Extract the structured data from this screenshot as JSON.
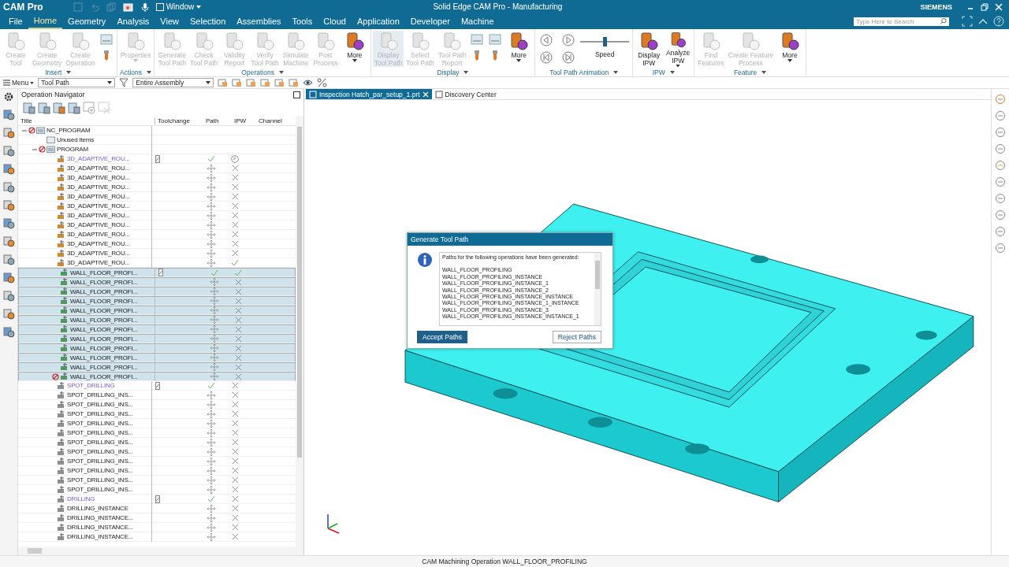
{
  "window": {
    "app_name": "CAM Pro",
    "quick_menu": "Window",
    "title": "Solid Edge CAM Pro - Manufacturing",
    "brand": "SIEMENS"
  },
  "menu": [
    {
      "label": "File",
      "selected": false
    },
    {
      "label": "Home",
      "selected": true
    },
    {
      "label": "Geometry",
      "selected": false
    },
    {
      "label": "Analysis",
      "selected": false
    },
    {
      "label": "View",
      "selected": false
    },
    {
      "label": "Selection",
      "selected": false
    },
    {
      "label": "Assemblies",
      "selected": false
    },
    {
      "label": "Tools",
      "selected": false
    },
    {
      "label": "Cloud",
      "selected": false
    },
    {
      "label": "Application",
      "selected": false
    },
    {
      "label": "Developer",
      "selected": false
    },
    {
      "label": "Machine",
      "selected": false
    }
  ],
  "search": {
    "placeholder": "Type Here to Search"
  },
  "ribbon": [
    {
      "label": "Insert",
      "kind": "buttons",
      "buttons": [
        {
          "kind": "large",
          "lines": [
            "Create",
            "Tool"
          ],
          "disabled": true,
          "pressed": false,
          "menu": false
        },
        {
          "kind": "large",
          "lines": [
            "Create",
            "Geometry"
          ],
          "disabled": true,
          "pressed": false,
          "menu": false
        },
        {
          "kind": "large",
          "lines": [
            "Create",
            "Operation"
          ],
          "disabled": true,
          "pressed": false,
          "menu": false
        },
        {
          "kind": "icon_stack"
        }
      ]
    },
    {
      "label": "Actions",
      "kind": "buttons",
      "buttons": [
        {
          "kind": "large",
          "lines": [
            "Properties"
          ],
          "disabled": true,
          "pressed": false,
          "menu": true
        }
      ]
    },
    {
      "label": "Operations",
      "kind": "buttons",
      "buttons": [
        {
          "kind": "large",
          "lines": [
            "Generate",
            "Tool Path"
          ],
          "disabled": true,
          "pressed": false,
          "menu": false
        },
        {
          "kind": "large",
          "lines": [
            "Check",
            "Tool Path"
          ],
          "disabled": true,
          "pressed": false,
          "menu": false
        },
        {
          "kind": "large",
          "lines": [
            "Validity",
            "Report"
          ],
          "disabled": true,
          "pressed": false,
          "menu": false
        },
        {
          "kind": "large",
          "lines": [
            "Verify",
            "Tool Path"
          ],
          "disabled": true,
          "pressed": false,
          "menu": false
        },
        {
          "kind": "large",
          "lines": [
            "Simulate",
            "Machine"
          ],
          "disabled": true,
          "pressed": false,
          "menu": false
        },
        {
          "kind": "large",
          "lines": [
            "Post",
            "Process"
          ],
          "disabled": true,
          "pressed": false,
          "menu": false
        },
        {
          "kind": "large",
          "lines": [
            "More"
          ],
          "disabled": false,
          "pressed": false,
          "menu": true
        }
      ]
    },
    {
      "label": "Display",
      "kind": "buttons",
      "buttons": [
        {
          "kind": "large",
          "lines": [
            "Display",
            "Tool Path"
          ],
          "disabled": true,
          "pressed": true,
          "menu": false
        },
        {
          "kind": "large",
          "lines": [
            "Select",
            "Tool Path"
          ],
          "disabled": true,
          "pressed": false,
          "menu": false
        },
        {
          "kind": "large",
          "lines": [
            "Tool Path",
            "Report"
          ],
          "disabled": true,
          "pressed": false,
          "menu": false
        },
        {
          "kind": "icon_stack"
        },
        {
          "kind": "icon_stack"
        },
        {
          "kind": "large",
          "lines": [
            "More"
          ],
          "disabled": false,
          "pressed": false,
          "menu": true
        }
      ]
    },
    {
      "label": "Tool Path Animation",
      "kind": "animation",
      "speed": {
        "label": "Speed",
        "level": 0.5
      }
    },
    {
      "label": "IPW",
      "kind": "buttons",
      "buttons": [
        {
          "kind": "large",
          "lines": [
            "Display",
            "IPW"
          ],
          "disabled": false,
          "pressed": false,
          "menu": false
        },
        {
          "kind": "large",
          "lines": [
            "Analyze",
            "IPW"
          ],
          "disabled": false,
          "pressed": false,
          "menu": true
        }
      ]
    },
    {
      "label": "Feature",
      "kind": "buttons",
      "buttons": [
        {
          "kind": "large",
          "lines": [
            "Find",
            "Features"
          ],
          "disabled": true,
          "pressed": false,
          "menu": false
        },
        {
          "kind": "large",
          "lines": [
            "Create Feature",
            "Process"
          ],
          "disabled": true,
          "pressed": false,
          "menu": false
        },
        {
          "kind": "large",
          "lines": [
            "More"
          ],
          "disabled": false,
          "pressed": false,
          "menu": true
        }
      ]
    }
  ],
  "toolbar": {
    "menu_label": "Menu",
    "filter": "Tool Path",
    "scope": "Entire Assembly"
  },
  "navigator": {
    "title": "Operation Navigator",
    "columns": [
      "Title",
      "Toolchange",
      "Path",
      "IPW",
      "Channel"
    ],
    "tree": [
      {
        "title": "NC_PROGRAM",
        "kind": "program",
        "expanded": true,
        "error": true,
        "selected": false,
        "children": [
          {
            "title": "Unused Items",
            "kind": "folder",
            "error": false,
            "selected": false
          },
          {
            "title": "PROGRAM",
            "kind": "program",
            "expanded": true,
            "error": true,
            "selected": false,
            "children": [
              {
                "title": "3D_ADAPTIVE_ROU...",
                "kind": "adaptive",
                "emphasized": true,
                "error": false,
                "selected": false,
                "toolchange": true,
                "path_done": true,
                "ipw_done": false,
                "ipw_pending": true
              },
              {
                "title": "3D_ADAPTIVE_ROU...",
                "kind": "adaptive",
                "emphasized": false,
                "error": false,
                "selected": false,
                "toolchange": false,
                "path_done": false,
                "ipw_done": false,
                "ipw_pending": false
              },
              {
                "title": "3D_ADAPTIVE_ROU...",
                "kind": "adaptive",
                "emphasized": false,
                "error": false,
                "selected": false,
                "toolchange": false,
                "path_done": false,
                "ipw_done": false,
                "ipw_pending": false
              },
              {
                "title": "3D_ADAPTIVE_ROU...",
                "kind": "adaptive",
                "emphasized": false,
                "error": false,
                "selected": false,
                "toolchange": false,
                "path_done": false,
                "ipw_done": false,
                "ipw_pending": false
              },
              {
                "title": "3D_ADAPTIVE_ROU...",
                "kind": "adaptive",
                "emphasized": false,
                "error": false,
                "selected": false,
                "toolchange": false,
                "path_done": false,
                "ipw_done": false,
                "ipw_pending": false
              },
              {
                "title": "3D_ADAPTIVE_ROU...",
                "kind": "adaptive",
                "emphasized": false,
                "error": false,
                "selected": false,
                "toolchange": false,
                "path_done": false,
                "ipw_done": false,
                "ipw_pending": false
              },
              {
                "title": "3D_ADAPTIVE_ROU...",
                "kind": "adaptive",
                "emphasized": false,
                "error": false,
                "selected": false,
                "toolchange": false,
                "path_done": false,
                "ipw_done": false,
                "ipw_pending": false
              },
              {
                "title": "3D_ADAPTIVE_ROU...",
                "kind": "adaptive",
                "emphasized": false,
                "error": false,
                "selected": false,
                "toolchange": false,
                "path_done": false,
                "ipw_done": false,
                "ipw_pending": false
              },
              {
                "title": "3D_ADAPTIVE_ROU...",
                "kind": "adaptive",
                "emphasized": false,
                "error": false,
                "selected": false,
                "toolchange": false,
                "path_done": false,
                "ipw_done": false,
                "ipw_pending": false
              },
              {
                "title": "3D_ADAPTIVE_ROU...",
                "kind": "adaptive",
                "emphasized": false,
                "error": false,
                "selected": false,
                "toolchange": false,
                "path_done": false,
                "ipw_done": false,
                "ipw_pending": false
              },
              {
                "title": "3D_ADAPTIVE_ROU...",
                "kind": "adaptive",
                "emphasized": false,
                "error": false,
                "selected": false,
                "toolchange": false,
                "path_done": false,
                "ipw_done": false,
                "ipw_pending": false
              },
              {
                "title": "3D_ADAPTIVE_ROU...",
                "kind": "adaptive",
                "emphasized": false,
                "error": false,
                "selected": false,
                "toolchange": false,
                "path_done": false,
                "ipw_done": true,
                "ipw_pending": false
              },
              {
                "title": "WALL_FLOOR_PROFI...",
                "kind": "wall",
                "emphasized": false,
                "error": false,
                "selected": true,
                "toolchange": true,
                "path_done": true,
                "ipw_done": true,
                "ipw_pending": false
              },
              {
                "title": "WALL_FLOOR_PROFI...",
                "kind": "wall",
                "emphasized": false,
                "error": false,
                "selected": true,
                "toolchange": false,
                "path_done": false,
                "ipw_done": false,
                "ipw_pending": false
              },
              {
                "title": "WALL_FLOOR_PROFI...",
                "kind": "wall",
                "emphasized": false,
                "error": false,
                "selected": true,
                "toolchange": false,
                "path_done": false,
                "ipw_done": false,
                "ipw_pending": false
              },
              {
                "title": "WALL_FLOOR_PROFI...",
                "kind": "wall",
                "emphasized": false,
                "error": false,
                "selected": true,
                "toolchange": false,
                "path_done": false,
                "ipw_done": false,
                "ipw_pending": false
              },
              {
                "title": "WALL_FLOOR_PROFI...",
                "kind": "wall",
                "emphasized": false,
                "error": false,
                "selected": true,
                "toolchange": false,
                "path_done": false,
                "ipw_done": false,
                "ipw_pending": false
              },
              {
                "title": "WALL_FLOOR_PROFI...",
                "kind": "wall",
                "emphasized": false,
                "error": false,
                "selected": true,
                "toolchange": false,
                "path_done": false,
                "ipw_done": false,
                "ipw_pending": false
              },
              {
                "title": "WALL_FLOOR_PROFI...",
                "kind": "wall",
                "emphasized": false,
                "error": false,
                "selected": true,
                "toolchange": false,
                "path_done": false,
                "ipw_done": false,
                "ipw_pending": false
              },
              {
                "title": "WALL_FLOOR_PROFI...",
                "kind": "wall",
                "emphasized": false,
                "error": false,
                "selected": true,
                "toolchange": false,
                "path_done": false,
                "ipw_done": false,
                "ipw_pending": false
              },
              {
                "title": "WALL_FLOOR_PROFI...",
                "kind": "wall",
                "emphasized": false,
                "error": false,
                "selected": true,
                "toolchange": false,
                "path_done": false,
                "ipw_done": false,
                "ipw_pending": false
              },
              {
                "title": "WALL_FLOOR_PROFI...",
                "kind": "wall",
                "emphasized": false,
                "error": false,
                "selected": true,
                "toolchange": false,
                "path_done": false,
                "ipw_done": false,
                "ipw_pending": false
              },
              {
                "title": "WALL_FLOOR_PROFI...",
                "kind": "wall",
                "emphasized": false,
                "error": false,
                "selected": true,
                "toolchange": false,
                "path_done": false,
                "ipw_done": false,
                "ipw_pending": false
              },
              {
                "title": "WALL_FLOOR_PROFI...",
                "kind": "wall",
                "emphasized": false,
                "error": true,
                "selected": true,
                "toolchange": false,
                "path_done": false,
                "ipw_done": false,
                "ipw_pending": false
              },
              {
                "title": "SPOT_DRILLING",
                "kind": "drill",
                "emphasized": true,
                "error": false,
                "selected": false,
                "toolchange": true,
                "path_done": true,
                "ipw_done": false,
                "ipw_pending": false
              },
              {
                "title": "SPOT_DRILLING_INS...",
                "kind": "drill",
                "emphasized": false,
                "error": false,
                "selected": false,
                "toolchange": false,
                "path_done": false,
                "ipw_done": false,
                "ipw_pending": false
              },
              {
                "title": "SPOT_DRILLING_INS...",
                "kind": "drill",
                "emphasized": false,
                "error": false,
                "selected": false,
                "toolchange": false,
                "path_done": false,
                "ipw_done": false,
                "ipw_pending": false
              },
              {
                "title": "SPOT_DRILLING_INS...",
                "kind": "drill",
                "emphasized": false,
                "error": false,
                "selected": false,
                "toolchange": false,
                "path_done": false,
                "ipw_done": false,
                "ipw_pending": false
              },
              {
                "title": "SPOT_DRILLING_INS...",
                "kind": "drill",
                "emphasized": false,
                "error": false,
                "selected": false,
                "toolchange": false,
                "path_done": false,
                "ipw_done": false,
                "ipw_pending": false
              },
              {
                "title": "SPOT_DRILLING_INS...",
                "kind": "drill",
                "emphasized": false,
                "error": false,
                "selected": false,
                "toolchange": false,
                "path_done": false,
                "ipw_done": false,
                "ipw_pending": false
              },
              {
                "title": "SPOT_DRILLING_INS...",
                "kind": "drill",
                "emphasized": false,
                "error": false,
                "selected": false,
                "toolchange": false,
                "path_done": false,
                "ipw_done": false,
                "ipw_pending": false
              },
              {
                "title": "SPOT_DRILLING_INS...",
                "kind": "drill",
                "emphasized": false,
                "error": false,
                "selected": false,
                "toolchange": false,
                "path_done": false,
                "ipw_done": false,
                "ipw_pending": false
              },
              {
                "title": "SPOT_DRILLING_INS...",
                "kind": "drill",
                "emphasized": false,
                "error": false,
                "selected": false,
                "toolchange": false,
                "path_done": false,
                "ipw_done": false,
                "ipw_pending": false
              },
              {
                "title": "SPOT_DRILLING_INS...",
                "kind": "drill",
                "emphasized": false,
                "error": false,
                "selected": false,
                "toolchange": false,
                "path_done": false,
                "ipw_done": false,
                "ipw_pending": false
              },
              {
                "title": "SPOT_DRILLING_INS...",
                "kind": "drill",
                "emphasized": false,
                "error": false,
                "selected": false,
                "toolchange": false,
                "path_done": false,
                "ipw_done": false,
                "ipw_pending": false
              },
              {
                "title": "SPOT_DRILLING_INS...",
                "kind": "drill",
                "emphasized": false,
                "error": false,
                "selected": false,
                "toolchange": false,
                "path_done": false,
                "ipw_done": false,
                "ipw_pending": false
              },
              {
                "title": "DRILLING",
                "kind": "drill",
                "emphasized": true,
                "error": false,
                "selected": false,
                "toolchange": true,
                "path_done": true,
                "ipw_done": false,
                "ipw_pending": false
              },
              {
                "title": "DRILLING_INSTANCE",
                "kind": "drill",
                "emphasized": false,
                "error": false,
                "selected": false,
                "toolchange": false,
                "path_done": false,
                "ipw_done": false,
                "ipw_pending": false
              },
              {
                "title": "DRILLING_INSTANCE...",
                "kind": "drill",
                "emphasized": false,
                "error": false,
                "selected": false,
                "toolchange": false,
                "path_done": false,
                "ipw_done": false,
                "ipw_pending": false
              },
              {
                "title": "DRILLING_INSTANCE...",
                "kind": "drill",
                "emphasized": false,
                "error": false,
                "selected": false,
                "toolchange": false,
                "path_done": false,
                "ipw_done": false,
                "ipw_pending": false
              },
              {
                "title": "DRILLING_INSTANCE...",
                "kind": "drill",
                "emphasized": false,
                "error": false,
                "selected": false,
                "toolchange": false,
                "path_done": false,
                "ipw_done": false,
                "ipw_pending": false
              }
            ]
          }
        ]
      }
    ]
  },
  "view_tabs": [
    {
      "label": "Inspection Hatch_par_setup_1.prt",
      "selected": true
    },
    {
      "label": "Discovery Center",
      "selected": false
    }
  ],
  "dialog": {
    "title": "Generate Tool Path",
    "message": "Paths for the following operations have been generated:",
    "items": [
      "WALL_FLOOR_PROFILING",
      "WALL_FLOOR_PROFILING_INSTANCE",
      "WALL_FLOOR_PROFILING_INSTANCE_1",
      "WALL_FLOOR_PROFILING_INSTANCE_2",
      "WALL_FLOOR_PROFILING_INSTANCE_INSTANCE",
      "WALL_FLOOR_PROFILING_INSTANCE_1_INSTANCE",
      "WALL_FLOOR_PROFILING_INSTANCE_3",
      "WALL_FLOOR_PROFILING_INSTANCE_INSTANCE_1"
    ],
    "buttons": [
      {
        "label": "Accept Paths",
        "selected": true
      },
      {
        "label": "Reject Paths",
        "selected": false
      }
    ]
  },
  "status_bar": "CAM Machining Operation WALL_FLOOR_PROFILING"
}
